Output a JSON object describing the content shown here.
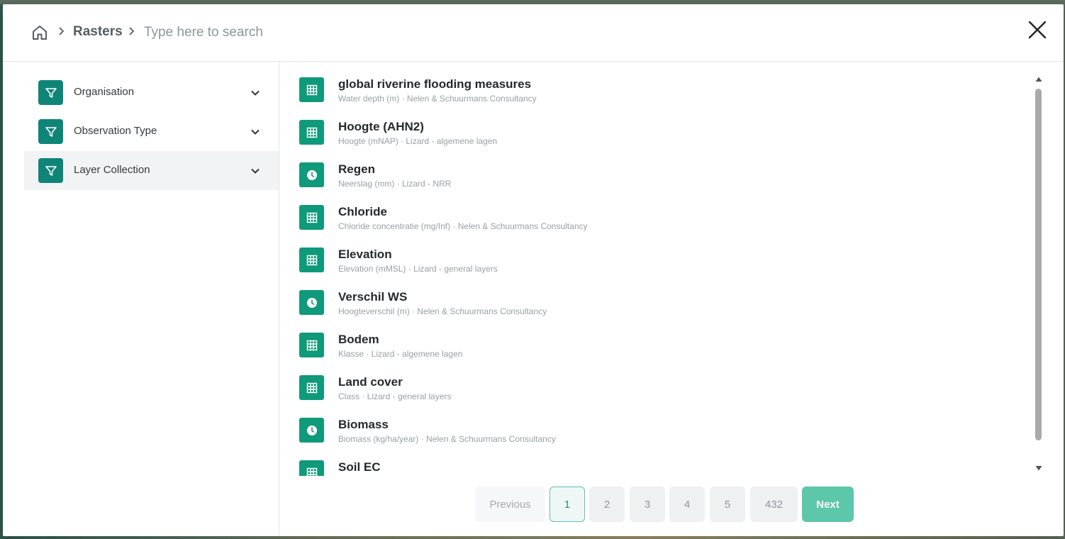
{
  "header": {
    "breadcrumb_label": "Rasters",
    "search_placeholder": "Type here to search"
  },
  "sidebar": {
    "filters": [
      {
        "label": "Organisation"
      },
      {
        "label": "Observation Type"
      },
      {
        "label": "Layer Collection"
      }
    ]
  },
  "results": [
    {
      "title": "global riverine flooding measures",
      "subtitle": "Water depth (m) · Nelen & Schuurmans Consultancy",
      "icon": "grid-icon"
    },
    {
      "title": "Hoogte (AHN2)",
      "subtitle": "Hoogte (mNAP) · Lizard - algemene lagen",
      "icon": "grid-icon"
    },
    {
      "title": "Regen",
      "subtitle": "Neerslag (mm) · Lizard - NRR",
      "icon": "clock-icon"
    },
    {
      "title": "Chloride",
      "subtitle": "Chloride concentratie (mg/Inf) · Nelen & Schuurmans Consultancy",
      "icon": "grid-icon"
    },
    {
      "title": "Elevation",
      "subtitle": "Elevation (mMSL) · Lizard - general layers",
      "icon": "grid-icon"
    },
    {
      "title": "Verschil WS",
      "subtitle": "Hoogteverschil (m) · Nelen & Schuurmans Consultancy",
      "icon": "clock-icon"
    },
    {
      "title": "Bodem",
      "subtitle": "Klasse · Lizard - algemene lagen",
      "icon": "grid-icon"
    },
    {
      "title": "Land cover",
      "subtitle": "Class · Lizard - general layers",
      "icon": "grid-icon"
    },
    {
      "title": "Biomass",
      "subtitle": "Biomass (kg/ha/year) · Nelen & Schuurmans Consultancy",
      "icon": "clock-icon"
    },
    {
      "title": "Soil EC",
      "subtitle": "",
      "icon": "grid-icon"
    }
  ],
  "pagination": {
    "previous": "Previous",
    "pages": [
      "1",
      "2",
      "3",
      "4",
      "5",
      "432"
    ],
    "current": "1",
    "next": "Next"
  },
  "colors": {
    "accent": "#0f8578",
    "next_button": "#5dc7a9"
  }
}
